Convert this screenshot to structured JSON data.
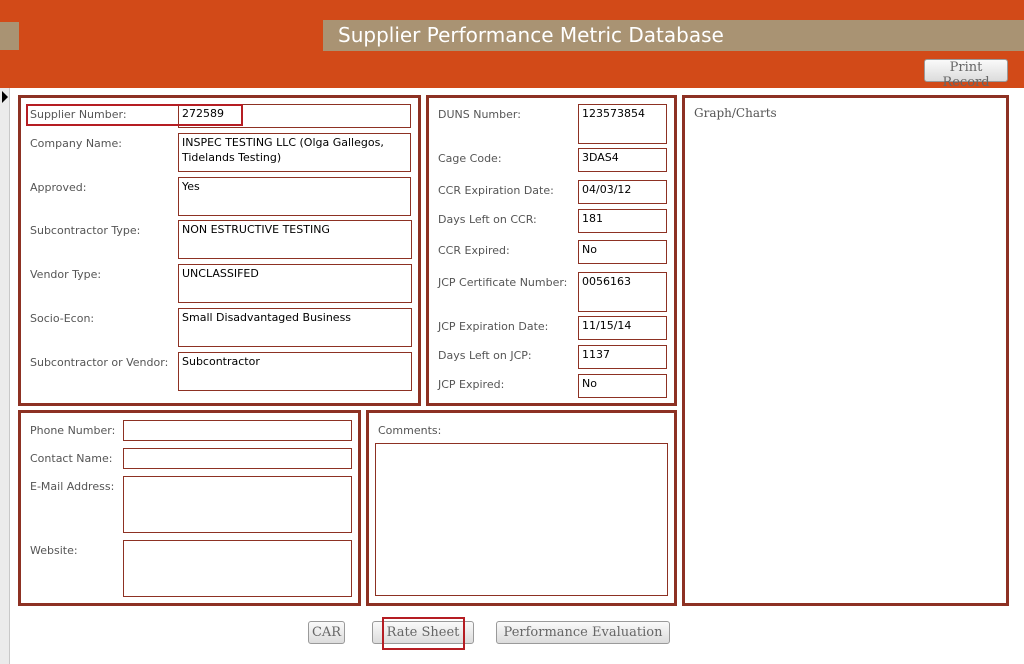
{
  "header": {
    "title": "Supplier Performance Metric Database",
    "print_label": "Print Record"
  },
  "supplier": {
    "supplier_number_label": "Supplier Number:",
    "supplier_number": "272589",
    "company_name_label": "Company Name:",
    "company_name": "INSPEC TESTING  LLC (Olga Gallegos, Tidelands Testing)",
    "approved_label": "Approved:",
    "approved": "Yes",
    "subcontractor_type_label": "Subcontractor Type:",
    "subcontractor_type": "NON ESTRUCTIVE TESTING",
    "vendor_type_label": "Vendor Type:",
    "vendor_type": "UNCLASSIFED",
    "socio_econ_label": "Socio-Econ:",
    "socio_econ": "Small Disadvantaged Business",
    "sub_or_vendor_label": "Subcontractor or Vendor:",
    "sub_or_vendor": "Subcontractor"
  },
  "registration": {
    "duns_label": "DUNS Number:",
    "duns": "123573854",
    "cage_label": "Cage Code:",
    "cage": "3DAS4",
    "ccr_exp_label": "CCR Expiration Date:",
    "ccr_exp": "04/03/12",
    "days_ccr_label": "Days Left on CCR:",
    "days_ccr": "181",
    "ccr_expired_label": "CCR Expired:",
    "ccr_expired": "No",
    "jcp_cert_label": "JCP Certificate Number:",
    "jcp_cert": "0056163",
    "jcp_exp_label": "JCP Expiration Date:",
    "jcp_exp": "11/15/14",
    "days_jcp_label": "Days Left on JCP:",
    "days_jcp": "1137",
    "jcp_expired_label": "JCP Expired:",
    "jcp_expired": "No"
  },
  "contact": {
    "phone_label": "Phone Number:",
    "phone": "",
    "contact_label": "Contact Name:",
    "contact": "",
    "email_label": "E-Mail Address:",
    "email": "",
    "website_label": "Website:",
    "website": ""
  },
  "comments": {
    "label": "Comments:",
    "value": ""
  },
  "graph": {
    "label": "Graph/Charts"
  },
  "footer": {
    "car_label": "CAR",
    "rate_sheet_label": "Rate Sheet",
    "performance_label": "Performance Evaluation"
  },
  "colors": {
    "header": "#d24a18",
    "title_bar": "#a99373",
    "border": "#8d3123",
    "highlight": "#b51d23"
  }
}
